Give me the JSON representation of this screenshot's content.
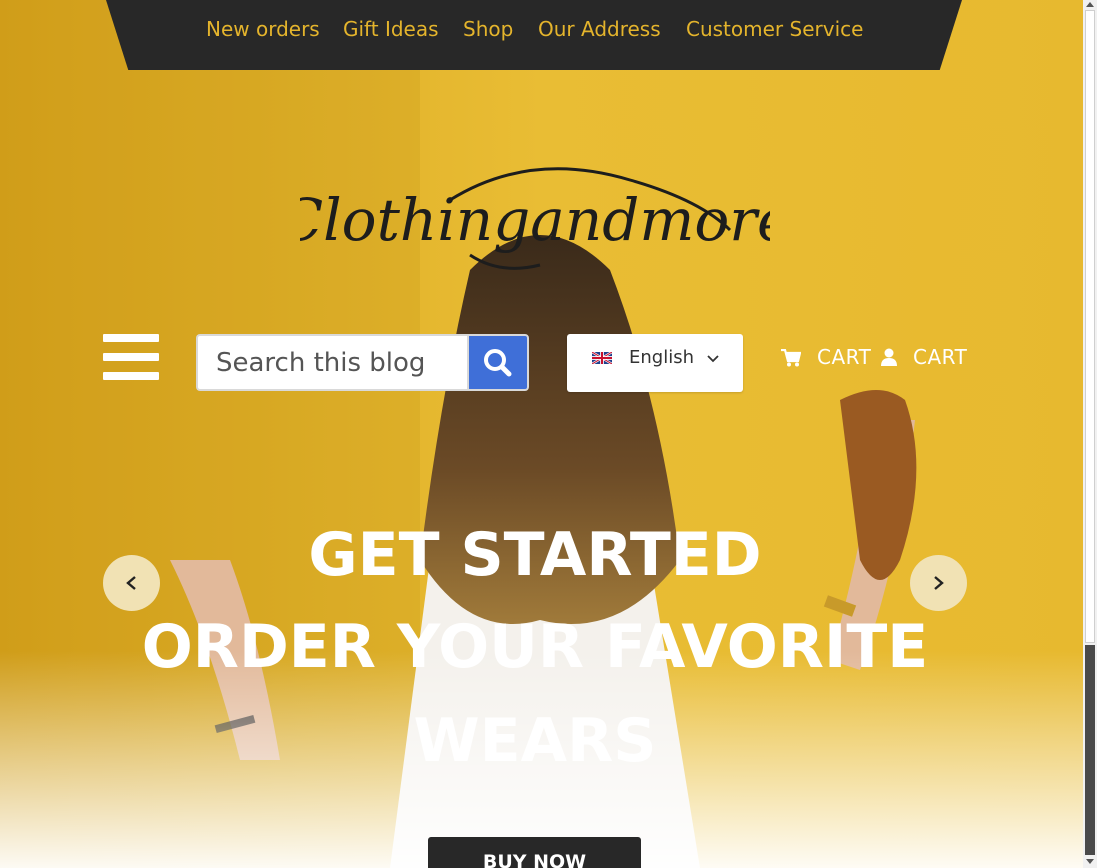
{
  "nav": {
    "items": [
      {
        "label": "New orders"
      },
      {
        "label": "Gift Ideas"
      },
      {
        "label": "Shop"
      },
      {
        "label": "Our Address"
      },
      {
        "label": "Customer Service"
      }
    ]
  },
  "brand": {
    "logo_text": "Clothingandmore"
  },
  "search": {
    "placeholder": "Search this blog",
    "icon": "search-icon"
  },
  "language": {
    "selected": "English",
    "flag_icon": "uk-flag-icon",
    "chevron_icon": "chevron-down-icon"
  },
  "cart": {
    "label_1": "CART",
    "label_2": "CART",
    "cart_icon": "shopping-cart-icon",
    "user_icon": "user-icon"
  },
  "hero": {
    "line1": "GET STARTED",
    "line2": "ORDER YOUR FAVORITE",
    "line3": "WEARS",
    "button": "BUY NOW"
  },
  "colors": {
    "accent": "#e4b42c",
    "nav_bg": "#282828",
    "search_button": "#3f6fd8",
    "arrow_bg": "#f1e2b4"
  }
}
